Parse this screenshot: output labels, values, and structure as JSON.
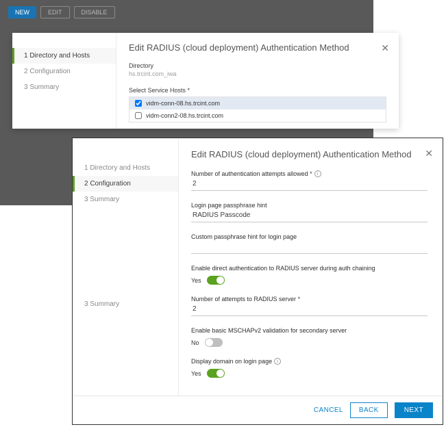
{
  "toolbar": {
    "new": "NEW",
    "edit": "EDIT",
    "disable": "DISABLE"
  },
  "modal1": {
    "title": "Edit RADIUS (cloud deployment) Authentication Method",
    "nav": {
      "step1": "1 Directory and Hosts",
      "step2": "2 Configuration",
      "step3": "3 Summary"
    },
    "directoryLabel": "Directory",
    "directoryValue": "hs.trcint.com_iwa",
    "hostsLabel": "Select Service Hosts *",
    "hosts": [
      {
        "name": "vidm-conn-08.hs.trcint.com",
        "checked": true
      },
      {
        "name": "vidm-conn2-08.hs.trcint.com",
        "checked": false
      }
    ]
  },
  "modal2": {
    "title": "Edit RADIUS (cloud deployment) Authentication Method",
    "nav": {
      "step1": "1 Directory and Hosts",
      "step2": "2 Configuration",
      "step3": "3 Summary"
    },
    "fields": {
      "attemptsLabel": "Number of authentication attempts allowed",
      "attemptsValue": "2",
      "hintLabel": "Login page passphrase hint",
      "hintValue": "RADIUS Passcode",
      "customHintLabel": "Custom passphrase hint for login page",
      "customHintValue": "",
      "directAuthLabel": "Enable direct authentication to RADIUS server during auth chaining",
      "directAuthYes": "Yes",
      "serverAttemptsLabel": "Number of attempts to RADIUS server",
      "serverAttemptsValue": "2",
      "mschapLabel": "Enable basic MSCHAPv2 validation for secondary server",
      "mschapNo": "No",
      "displayDomainLabel": "Display domain on login page",
      "displayDomainYes": "Yes"
    },
    "footer": {
      "cancel": "CANCEL",
      "back": "BACK",
      "next": "NEXT"
    }
  }
}
